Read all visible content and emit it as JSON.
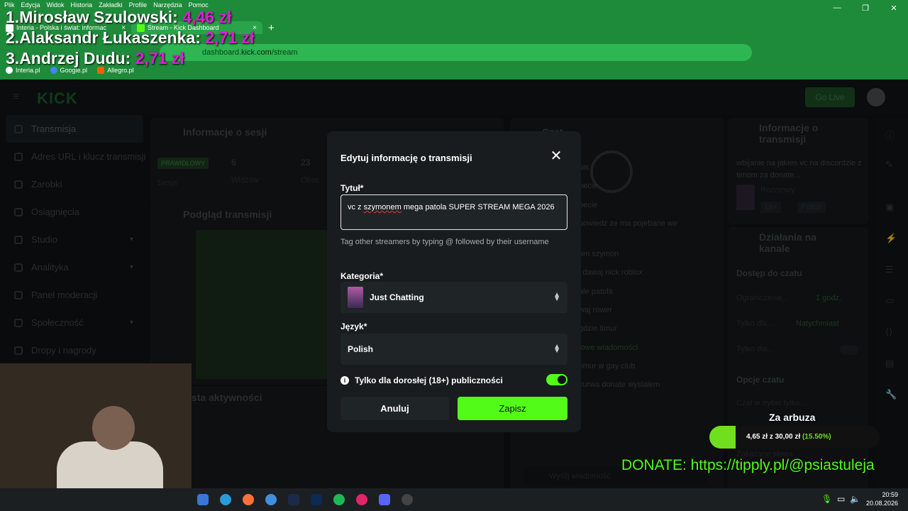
{
  "browser": {
    "menu": [
      "Plik",
      "Edycja",
      "Widok",
      "Historia",
      "Zakładki",
      "Profile",
      "Narzędzia",
      "Pomoc"
    ],
    "tabs": [
      {
        "title": "Interia - Polska i świat: informac",
        "close": "×"
      },
      {
        "title": "Stream - Kick Dashboard",
        "close": "×"
      }
    ],
    "new_tab": "+",
    "url_host_prefix": "dashboard.",
    "url_host": "kick.com",
    "url_path": "/stream",
    "bookmarks": [
      "Interia.pl",
      "Google.pl",
      "Allegro.pl"
    ]
  },
  "overlay": {
    "donors": [
      {
        "rank": "1.",
        "name": "Mirosław Szulowski:",
        "amount": "4,46 zł"
      },
      {
        "rank": "2.",
        "name": "Alaksandr Łukaszenka:",
        "amount": "2,71 zł"
      },
      {
        "rank": "3.",
        "name": "Andrzej Dudu:",
        "amount": "2,71 zł"
      }
    ]
  },
  "kick": {
    "logo": "KICK",
    "go_live": "Go Live",
    "sidebar": [
      {
        "label": "Transmisja",
        "active": true
      },
      {
        "label": "Adres URL i klucz transmisji"
      },
      {
        "label": "Zarobki"
      },
      {
        "label": "Osiągnięcia"
      },
      {
        "label": "Studio",
        "chevron": true
      },
      {
        "label": "Analityka",
        "chevron": true
      },
      {
        "label": "Panel moderacji"
      },
      {
        "label": "Społeczność",
        "chevron": true
      },
      {
        "label": "Dropy i nagrody"
      }
    ],
    "session_title": "Informacje o sesji",
    "session_badge": "PRAWIDŁOWY",
    "session_label": "Sesja",
    "viewers_value": "6",
    "viewers_label": "Widzów",
    "observers_value": "23",
    "observers_label": "Obse",
    "preview_title": "Podgląd transmisji",
    "activity_title": "sta aktywności",
    "chat_title": "Czat",
    "chat_lines": [
      "pis",
      "pecie",
      "pecie",
      "powiedz ze ma pojebane we",
      "ten szymon",
      "i dawaj nick roblox",
      "ale patola",
      "waj rower",
      "gdzie timur",
      "lowe wiadomości",
      "timur w gay club",
      "kurwa donate wyslalem"
    ],
    "chat_input_placeholder": "Wyślij wiadomość",
    "stream_info_title": "Informacje o transmisji",
    "stream_info_desc": "wbijanie na jakies vc na discordzie z timom za donate...",
    "stream_info_category": "Rozmowy",
    "stream_info_tags": [
      "18+",
      "Polish"
    ],
    "actions_title": "Działania na kanale",
    "chat_access": "Dostęp do czatu",
    "limits_label": "Ograniczenie...",
    "limits_value": "1 godz.",
    "only_for_label": "Tylko dla...",
    "only_for_value": "Natychmiast",
    "only_for2_label": "Tylko dla...",
    "chat_options": "Opcje czatu",
    "slow_mode": "Czat w trybie tylko...",
    "forbidden_words": "Zakazane słowa"
  },
  "modal": {
    "title": "Edytuj informację o transmisji",
    "close": "✕",
    "title_label": "Tytuł*",
    "title_value_prefix": "vc z ",
    "title_value_misspelled": "szymonem",
    "title_value_rest": " mega patola SUPER STREAM MEGA 2026",
    "hint": "Tag other streamers by typing @ followed by their username",
    "category_label": "Kategoria*",
    "category_value": "Just Chatting",
    "language_label": "Język*",
    "language_value": "Polish",
    "adult_label": "Tylko dla dorosłej (18+) publiczności",
    "adult_enabled": true,
    "cancel": "Anuluj",
    "save": "Zapisz"
  },
  "goal": {
    "title": "Za arbuza",
    "current": "4,65 zł",
    "separator": "z",
    "target": "30,00 zł",
    "percent": "(15.50%)",
    "progress": 0.155
  },
  "donate_text": "DONATE: https://tipply.pl/@psiastuleja",
  "taskbar": {
    "time": "20:59",
    "date": "20.08.2026"
  },
  "colors": {
    "kick_green": "#53fc18",
    "browser_green": "#1e8b3a",
    "overlay_magenta": "#e21cd8"
  }
}
